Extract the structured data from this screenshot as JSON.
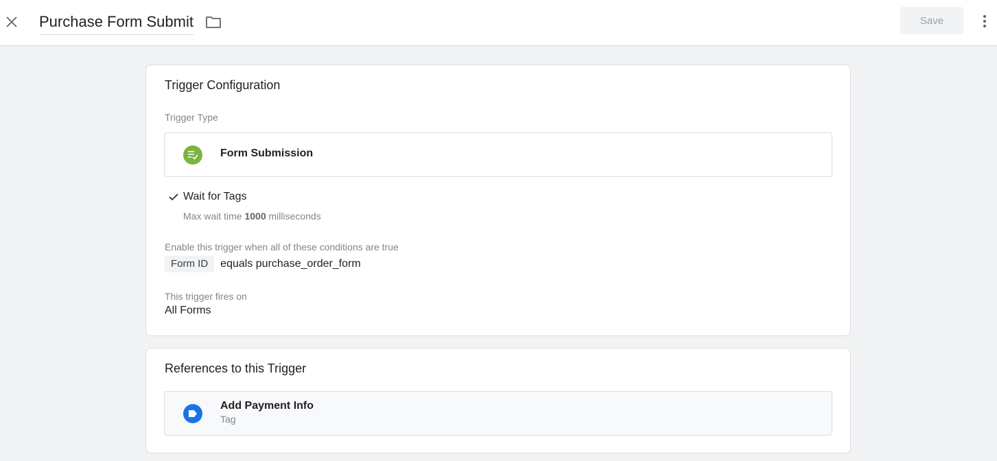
{
  "header": {
    "close_icon": "close-icon",
    "title": "Purchase Form Submit",
    "folder_icon": "folder-icon",
    "save_label": "Save",
    "more_icon": "more-vert-icon"
  },
  "trigger_config": {
    "heading": "Trigger Configuration",
    "type_label": "Trigger Type",
    "type_name": "Form Submission",
    "type_icon": "form-submission-icon",
    "type_icon_color": "#7cb342",
    "wait_for_tags": {
      "checked": true,
      "label": "Wait for Tags",
      "max_wait_prefix": "Max wait time",
      "max_wait_value": "1000",
      "max_wait_suffix": "milliseconds"
    },
    "conditions_label": "Enable this trigger when all of these conditions are true",
    "condition": {
      "variable": "Form ID",
      "operator_value": "equals purchase_order_form"
    },
    "fires_on_label": "This trigger fires on",
    "fires_on_value": "All Forms"
  },
  "references": {
    "heading": "References to this Trigger",
    "items": [
      {
        "name": "Add Payment Info",
        "kind": "Tag",
        "icon": "tag-icon",
        "icon_color": "#1a73e8"
      }
    ]
  }
}
